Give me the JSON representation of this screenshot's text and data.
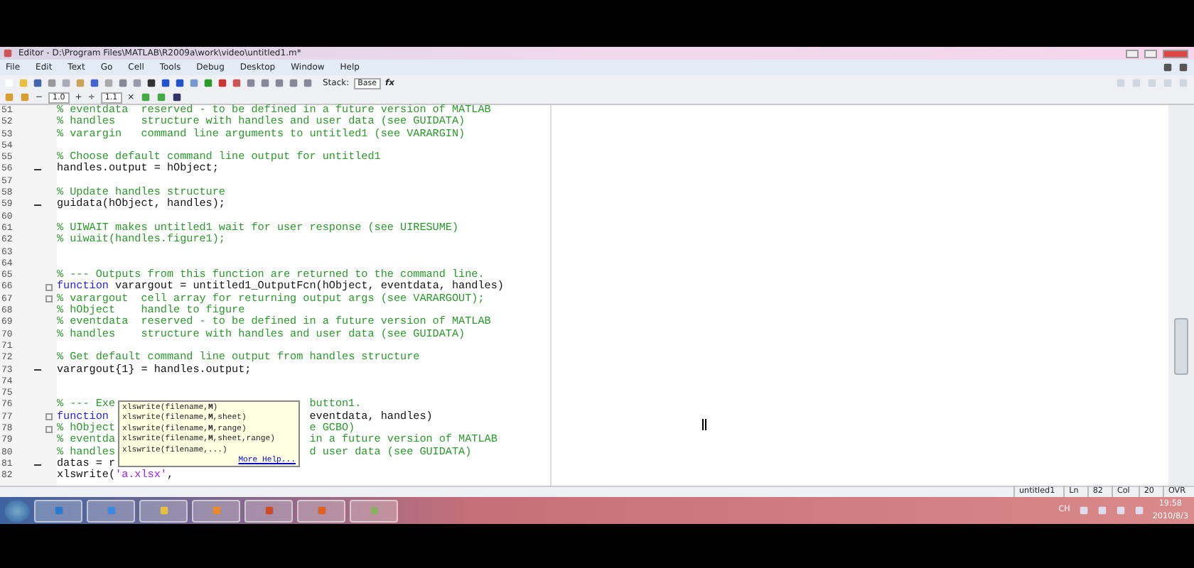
{
  "window": {
    "title": "Editor - D:\\Program Files\\MATLAB\\R2009a\\work\\video\\untitled1.m*"
  },
  "menu": [
    "File",
    "Edit",
    "Text",
    "Go",
    "Cell",
    "Tools",
    "Debug",
    "Desktop",
    "Window",
    "Help"
  ],
  "toolbar": {
    "stack_label": "Stack:",
    "stack_value": "Base",
    "fx": "fx"
  },
  "cell_toolbar": {
    "minus": "−",
    "value_1": "1.0",
    "plus": "+",
    "divide": "÷",
    "value_2": "1.1",
    "times": "×"
  },
  "editor": {
    "lines": [
      {
        "number": "51",
        "tokens": [
          {
            "kind": "comment",
            "text": "% eventdata  reserved - to be defined in a future version of MATLAB"
          }
        ]
      },
      {
        "number": "52",
        "tokens": [
          {
            "kind": "comment",
            "text": "% handles    structure with handles and user data (see GUIDATA)"
          }
        ]
      },
      {
        "number": "53",
        "tokens": [
          {
            "kind": "comment",
            "text": "% varargin   command line arguments to untitled1 (see VARARGIN)"
          }
        ]
      },
      {
        "number": "54"
      },
      {
        "number": "55",
        "tokens": [
          {
            "kind": "comment",
            "text": "% Choose default command line output for untitled1"
          }
        ]
      },
      {
        "number": "56",
        "executable": true,
        "tokens": [
          {
            "kind": "code",
            "text": "handles.output = hObject;"
          }
        ]
      },
      {
        "number": "57"
      },
      {
        "number": "58",
        "tokens": [
          {
            "kind": "comment",
            "text": "% Update handles structure"
          }
        ]
      },
      {
        "number": "59",
        "executable": true,
        "tokens": [
          {
            "kind": "code",
            "text": "guidata(hObject, handles);"
          }
        ]
      },
      {
        "number": "60"
      },
      {
        "number": "61",
        "tokens": [
          {
            "kind": "comment",
            "text": "% UIWAIT makes untitled1 wait for user response (see UIRESUME)"
          }
        ]
      },
      {
        "number": "62",
        "tokens": [
          {
            "kind": "comment",
            "text": "% uiwait(handles.figure1);"
          }
        ]
      },
      {
        "number": "63"
      },
      {
        "number": "64"
      },
      {
        "number": "65",
        "tokens": [
          {
            "kind": "comment",
            "text": "% --- Outputs from this function are returned to the command line."
          }
        ]
      },
      {
        "number": "66",
        "fold": true,
        "tokens": [
          {
            "kind": "keyword",
            "text": "function"
          },
          {
            "kind": "code",
            "text": " varargout = untitled1_OutputFcn(hObject, eventdata, handles)"
          }
        ]
      },
      {
        "number": "67",
        "fold": true,
        "tokens": [
          {
            "kind": "comment",
            "text": "% varargout  cell array for returning output args (see VARARGOUT);"
          }
        ]
      },
      {
        "number": "68",
        "tokens": [
          {
            "kind": "comment",
            "text": "% hObject    handle to figure"
          }
        ]
      },
      {
        "number": "69",
        "tokens": [
          {
            "kind": "comment",
            "text": "% eventdata  reserved - to be defined in a future version of MATLAB"
          }
        ]
      },
      {
        "number": "70",
        "tokens": [
          {
            "kind": "comment",
            "text": "% handles    structure with handles and user data (see GUIDATA)"
          }
        ]
      },
      {
        "number": "71"
      },
      {
        "number": "72",
        "tokens": [
          {
            "kind": "comment",
            "text": "% Get default command line output from handles structure"
          }
        ]
      },
      {
        "number": "73",
        "executable": true,
        "tokens": [
          {
            "kind": "code",
            "text": "varargout{1} = handles.output;"
          }
        ]
      },
      {
        "number": "74"
      },
      {
        "number": "75"
      },
      {
        "number": "76",
        "tokens": [
          {
            "kind": "comment",
            "text": "% --- Exe"
          }
        ],
        "tail": [
          {
            "kind": "comment",
            "text": "button1."
          }
        ]
      },
      {
        "number": "77",
        "fold": true,
        "tokens": [
          {
            "kind": "keyword",
            "text": "function"
          }
        ],
        "tail": [
          {
            "kind": "code",
            "text": "eventdata, handles)"
          }
        ]
      },
      {
        "number": "78",
        "fold": true,
        "tokens": [
          {
            "kind": "comment",
            "text": "% hObject"
          }
        ],
        "tail": [
          {
            "kind": "comment",
            "text": "e GCBO)"
          }
        ]
      },
      {
        "number": "79",
        "tokens": [
          {
            "kind": "comment",
            "text": "% eventda"
          }
        ],
        "tail": [
          {
            "kind": "comment",
            "text": "in a future version of MATLAB"
          }
        ]
      },
      {
        "number": "80",
        "tokens": [
          {
            "kind": "comment",
            "text": "% handles"
          }
        ],
        "tail": [
          {
            "kind": "comment",
            "text": "d user data (see GUIDATA)"
          }
        ]
      },
      {
        "number": "81",
        "executable": true,
        "tokens": [
          {
            "kind": "code",
            "text": "datas = r"
          }
        ]
      },
      {
        "number": "82",
        "tokens": [
          {
            "kind": "code",
            "text": "xlswrite("
          },
          {
            "kind": "string",
            "text": "'a.xlsx'"
          },
          {
            "kind": "code",
            "text": ","
          }
        ]
      }
    ]
  },
  "hint_popup": {
    "items": [
      "xlswrite(filename,**M**)",
      "xlswrite(filename,**M**,sheet)",
      "xlswrite(filename,**M**,range)",
      "xlswrite(filename,**M**,sheet,range)",
      "xlswrite(filename,...)"
    ],
    "link": "More Help..."
  },
  "status_bar": {
    "file": "untitled1",
    "ln_label": "Ln",
    "ln": "82",
    "col_label": "Col",
    "col": "20",
    "mode": "OVR"
  },
  "taskbar": {
    "language": "CH",
    "time": "19:58",
    "date": "2010/8/3"
  }
}
